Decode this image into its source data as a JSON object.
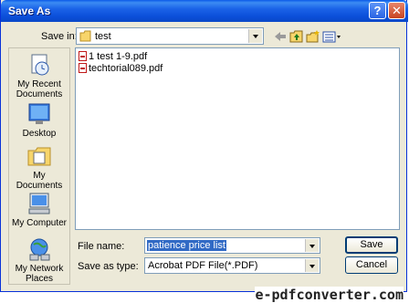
{
  "window": {
    "title": "Save As",
    "help_glyph": "?",
    "close_glyph": "✕"
  },
  "save_in": {
    "label": "Save in:",
    "value": "test"
  },
  "places": [
    {
      "label": "My Recent Documents",
      "icon": "recent-documents-icon"
    },
    {
      "label": "Desktop",
      "icon": "desktop-icon"
    },
    {
      "label": "My Documents",
      "icon": "my-documents-icon"
    },
    {
      "label": "My Computer",
      "icon": "my-computer-icon"
    },
    {
      "label": "My Network Places",
      "icon": "network-places-icon"
    }
  ],
  "files": [
    {
      "name": "1 test 1-9.pdf"
    },
    {
      "name": "techtorial089.pdf"
    }
  ],
  "file_name": {
    "label": "File name:",
    "value": "patience price list"
  },
  "save_as_type": {
    "label": "Save as type:",
    "value": "Acrobat PDF File(*.PDF)"
  },
  "buttons": {
    "save": "Save",
    "cancel": "Cancel"
  },
  "watermark": "e-pdfconverter.com"
}
